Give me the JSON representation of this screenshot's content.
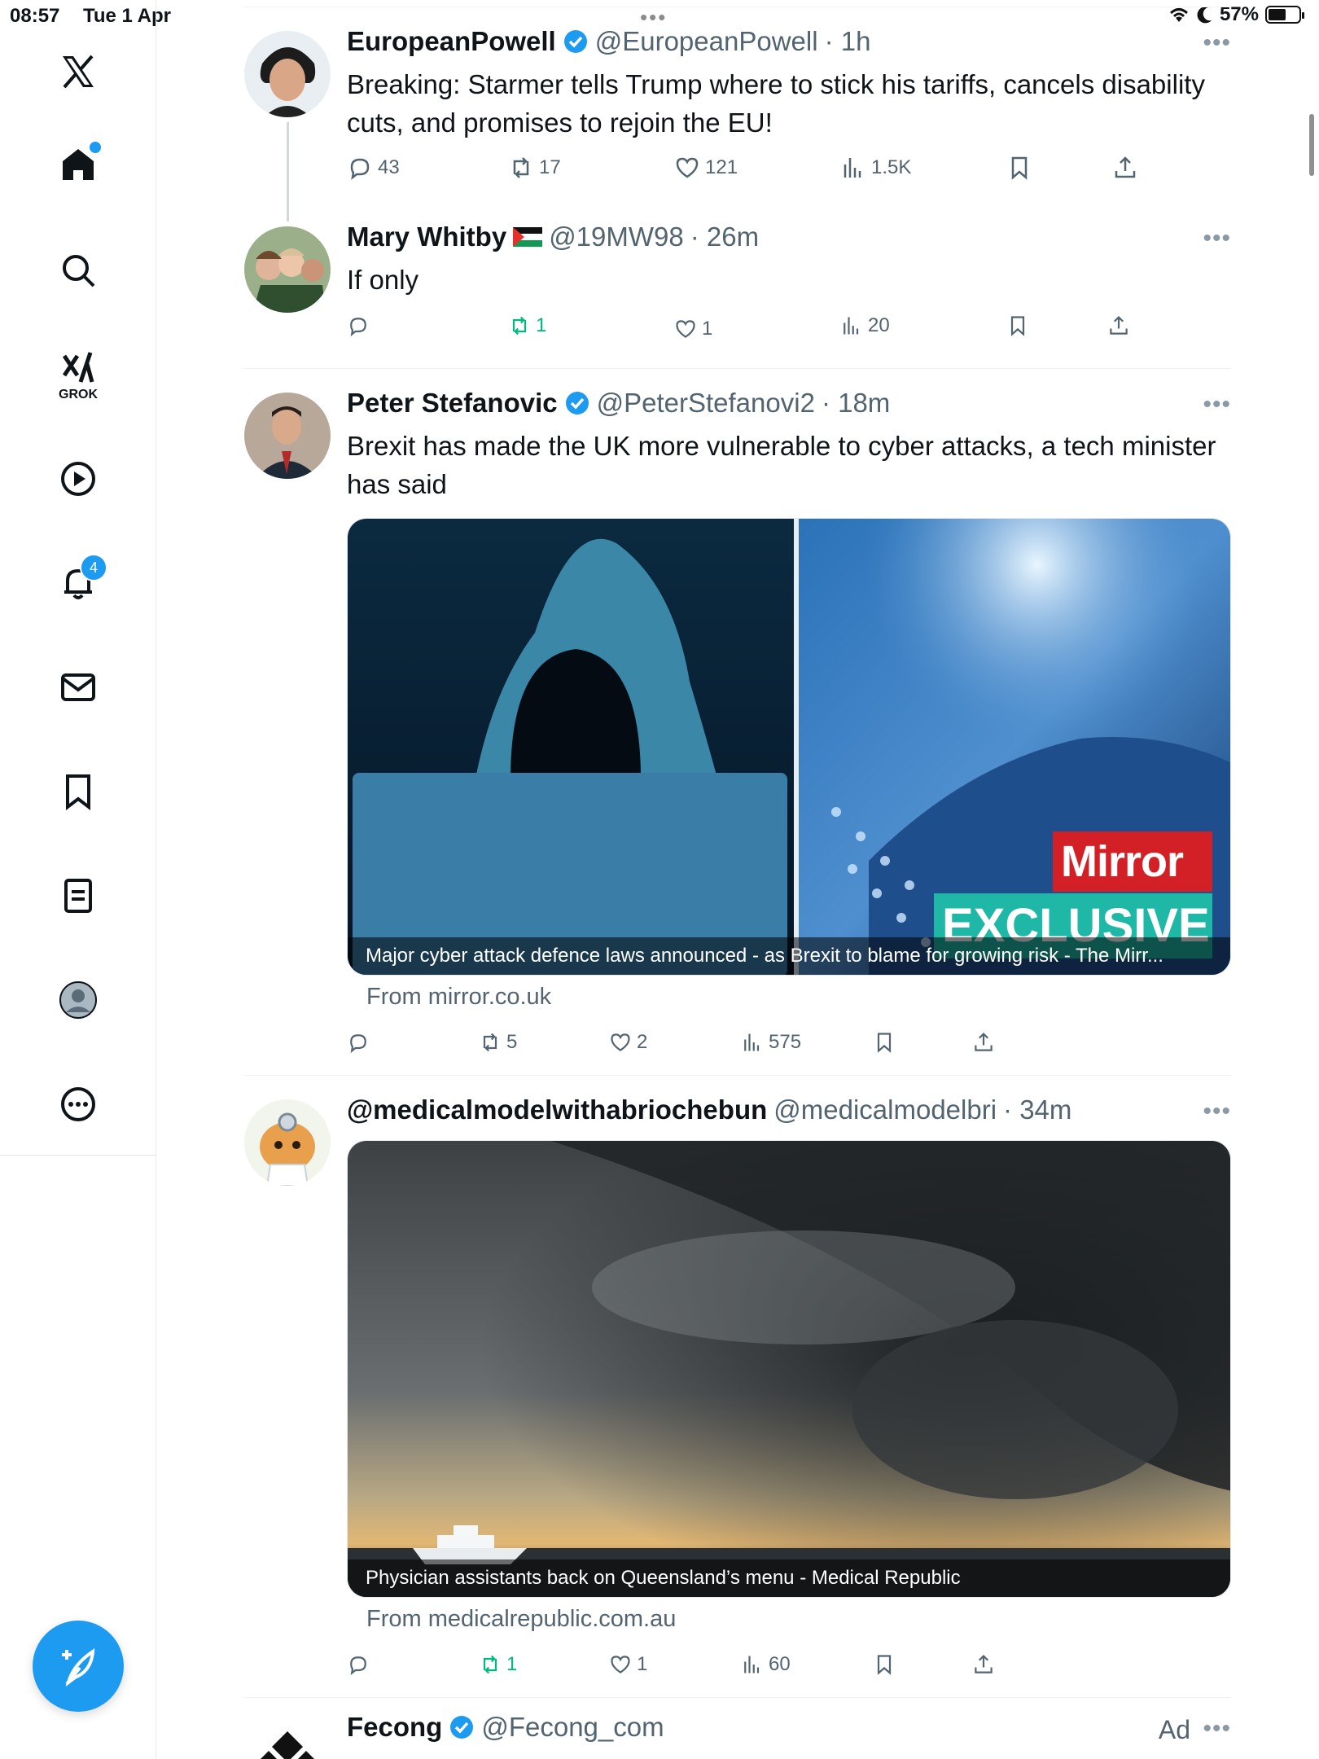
{
  "status_bar": {
    "time": "08:57",
    "date": "Tue 1 Apr",
    "battery": "57%",
    "battery_level": 0.57
  },
  "sidebar": {
    "grok_label": "GROK",
    "notifications_badge": "4",
    "compose_label": "+"
  },
  "tweets": [
    {
      "name": "EuropeanPowell",
      "handle": "@EuropeanPowell",
      "time": "· 1h",
      "text": "Breaking: Starmer tells Trump where to stick his tariffs, cancels disability cuts, and promises to rejoin the EU!",
      "replies": "43",
      "reposts": "17",
      "likes": "121",
      "views": "1.5K"
    },
    {
      "name": "Mary Whitby",
      "handle": "@19MW98",
      "time": "· 26m",
      "text": "If only",
      "replies": "",
      "reposts": "1",
      "likes": "1",
      "views": "20"
    },
    {
      "name": "Peter Stefanovic",
      "handle": "@PeterStefanovi2",
      "time": "· 18m",
      "text": "Brexit has made the UK more vulnerable to cyber attacks, a tech minister has said",
      "media_caption": "Major cyber attack defence laws announced - as Brexit to blame for growing risk - The Mirr...",
      "media_brand": "Mirror",
      "media_tag": "EXCLUSIVE",
      "source": "From mirror.co.uk",
      "replies": "",
      "reposts": "5",
      "likes": "2",
      "views": "575"
    },
    {
      "name": "@medicalmodelwithabriochebun",
      "handle": "@medicalmodelbri",
      "time": "· 34m",
      "media_caption": "Physician assistants back on Queensland’s menu - Medical Republic",
      "source": "From medicalrepublic.com.au",
      "replies": "",
      "reposts": "1",
      "likes": "1",
      "views": "60"
    },
    {
      "name": "Fecong",
      "handle": "@Fecong_com",
      "ad_label": "Ad"
    }
  ],
  "colors": {
    "accent": "#1d9bf0",
    "repost_active": "#00ba7c",
    "secondary_text": "#536471"
  }
}
